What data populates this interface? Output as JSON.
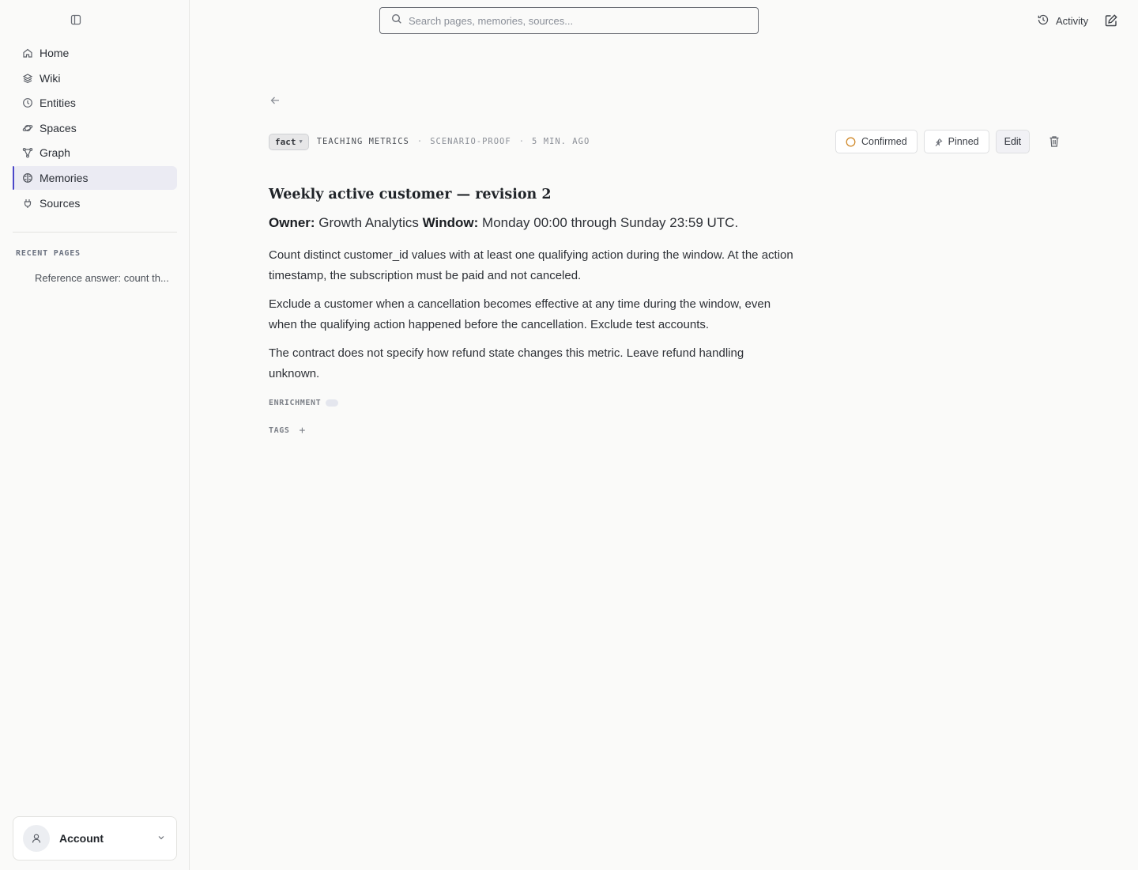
{
  "sidebar": {
    "items": [
      {
        "label": "Home",
        "icon": "home-icon"
      },
      {
        "label": "Wiki",
        "icon": "layers-icon"
      },
      {
        "label": "Entities",
        "icon": "clock-icon"
      },
      {
        "label": "Spaces",
        "icon": "planet-icon"
      },
      {
        "label": "Graph",
        "icon": "graph-icon"
      },
      {
        "label": "Memories",
        "icon": "brain-icon",
        "active": true
      },
      {
        "label": "Sources",
        "icon": "plug-icon"
      }
    ],
    "recent_heading": "RECENT PAGES",
    "recent_pages": [
      "Reference answer: count th..."
    ],
    "account_label": "Account"
  },
  "topbar": {
    "search_placeholder": "Search pages, memories, sources...",
    "activity_label": "Activity"
  },
  "memory": {
    "type": "fact",
    "space": "TEACHING METRICS",
    "scenario": "SCENARIO-PROOF",
    "time": "5 MIN. AGO",
    "status": "Confirmed",
    "pinned": "Pinned",
    "edit": "Edit",
    "title": "Weekly active customer — revision 2",
    "owner_label": "Owner:",
    "owner_value": "Growth Analytics",
    "window_label": "Window:",
    "window_value": "Monday 00:00 through Sunday 23:59 UTC.",
    "paragraphs": [
      "Count distinct customer_id values with at least one qualifying action during the window. At the action timestamp, the subscription must be paid and not canceled.",
      "Exclude a customer when a cancellation becomes effective at any time during the window, even when the qualifying action happened before the cancellation. Exclude test accounts.",
      "The contract does not specify how refund state changes this metric. Leave refund handling unknown."
    ],
    "enrichment_label": "ENRICHMENT",
    "tags_label": "TAGS",
    "add_tag": "+"
  },
  "colors": {
    "accent": "#4b47c9",
    "status_ring": "#d08a2c",
    "background": "#fafaf9"
  }
}
